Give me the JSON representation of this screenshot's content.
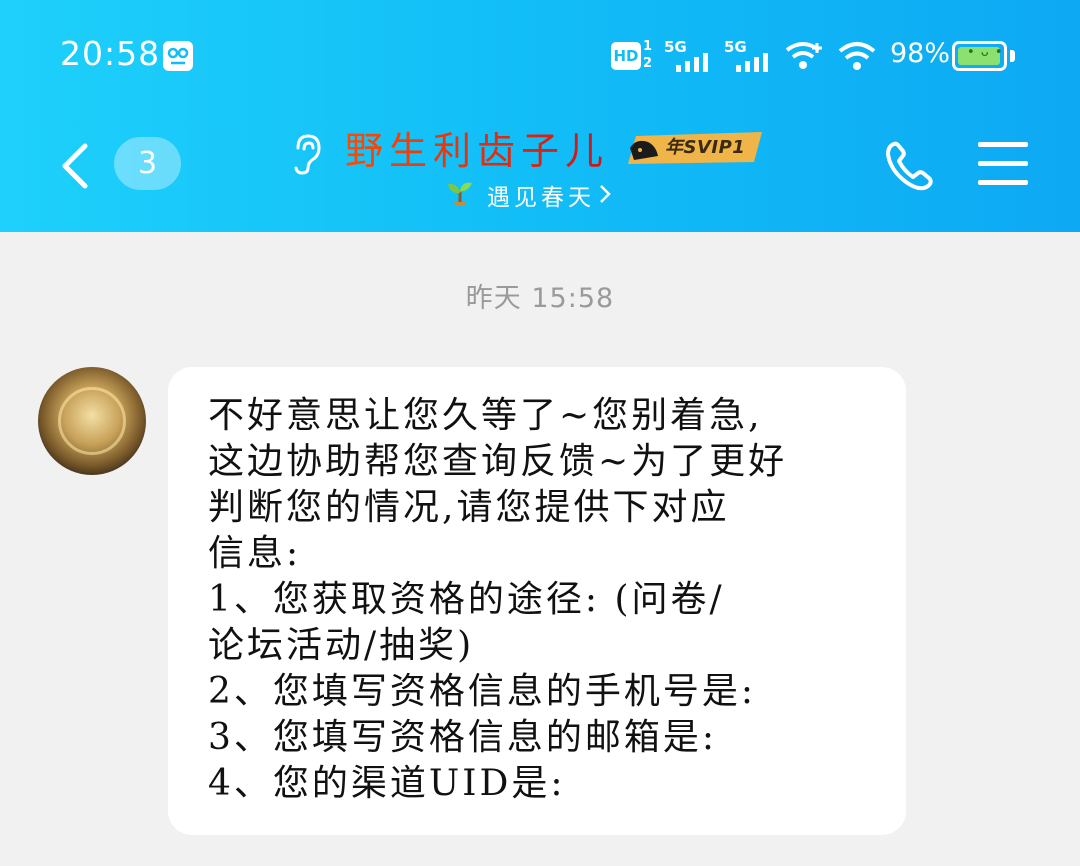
{
  "status_bar": {
    "time": "20:58",
    "hd_label": "HD",
    "hd_sims": [
      "1",
      "2"
    ],
    "network_1": "5G",
    "network_2": "5G",
    "battery_percent": "98%",
    "battery_level": 0.98,
    "battery_face": "• ᴗ •",
    "icons": [
      "screen-record-icon",
      "hd-voice-icon",
      "signal-icon",
      "wifi-plus-icon",
      "wifi-icon",
      "battery-icon"
    ]
  },
  "nav": {
    "unread_count": "3",
    "title": "野生利齿子儿",
    "vip_badge": "年SVIP1",
    "subtitle": "遇见春天",
    "title_gradient": [
      "#ff4a00",
      "#c9151b"
    ],
    "icons": [
      "back-icon",
      "ear-icon",
      "sprout-icon",
      "chevron-right-icon",
      "phone-icon",
      "menu-icon"
    ]
  },
  "chat": {
    "timestamp": "昨天 15:58",
    "message_lines": [
      "不好意思让您久等了~您别着急,",
      "这边协助帮您查询反馈~为了更好",
      "判断您的情况,请您提供下对应",
      "信息:",
      "1、您获取资格的途径: (问卷/",
      "论坛活动/抽奖)",
      "2、您填写资格信息的手机号是:",
      "3、您填写资格信息的邮箱是:",
      "4、您的渠道UID是:"
    ]
  },
  "colors": {
    "header_start": "#1ed0fb",
    "header_end": "#0da9f3",
    "background": "#f1f1f1",
    "bubble": "#ffffff"
  }
}
